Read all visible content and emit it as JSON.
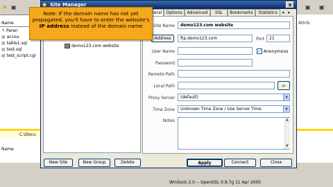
{
  "window": {
    "title": "Site Manager",
    "close_label": "x"
  },
  "tree": {
    "items": [
      {
        "label": "demo123.com website"
      }
    ]
  },
  "tabs": [
    {
      "label": "General",
      "active": true
    },
    {
      "label": "Options",
      "active": false
    },
    {
      "label": "Advanced",
      "active": false
    },
    {
      "label": "SSL",
      "active": false
    },
    {
      "label": "Bookmarks",
      "active": false
    },
    {
      "label": "Statistics",
      "active": false
    }
  ],
  "form": {
    "site_name_label": "Site Name",
    "site_name_value": "demo123.com website",
    "address_button": "Address",
    "address_value": "ftp.demo123.com",
    "port_label": "Port",
    "port_value": "21",
    "username_label": "User Name",
    "username_value": "",
    "anonymous_label": "Anonymous",
    "anonymous_checked": true,
    "password_label": "Password",
    "password_value": "",
    "remote_path_label": "Remote Path",
    "remote_path_value": "",
    "local_path_label": "Local Path",
    "local_path_value": "",
    "proxy_server_label": "Proxy Server",
    "proxy_server_value": "(default)",
    "time_zone_label": "Time Zone",
    "time_zone_value": "Unknown Time Zone / Use Server Time",
    "notes_label": "Notes",
    "notes_value": ""
  },
  "buttons": {
    "new_site": "New Site",
    "new_group": "New Group",
    "delete": "Delete",
    "apply": "Apply",
    "connect": "Connect",
    "close": "Close"
  },
  "note": {
    "line1": "Note: If the domain name has not yet",
    "line2": "propagated, you'll have to enter the website's",
    "bold": "IP address",
    "line3_rest": " instead of the domain name"
  },
  "background": {
    "left_header": "Name",
    "left_items": [
      "Paren",
      "accou",
      "table1.sql",
      "test.sql",
      "test_script.cgi"
    ],
    "left_header_bottom": "Name",
    "path_text": "C:\\Docu",
    "right_header": "Attrib",
    "status_text": "WinSock 2.0 -- OpenSSL 0.9.7g 11 Apr 2005"
  },
  "colors": {
    "note_bg": "#f5a81c",
    "title_bar": "#0a246a",
    "highlight_bar": "#ffd800"
  }
}
